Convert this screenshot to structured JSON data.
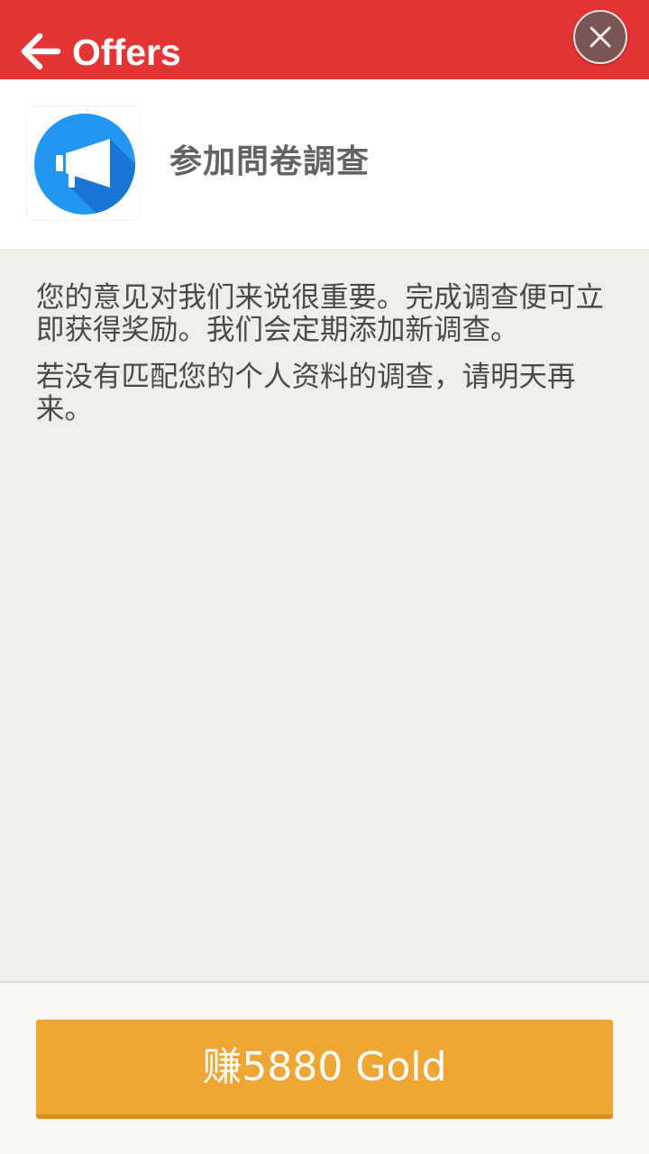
{
  "header": {
    "title": "Offers",
    "back_icon": "arrow-left-icon",
    "close_icon": "close-icon",
    "background_color": "#e53435"
  },
  "offer": {
    "icon": "megaphone-icon",
    "icon_color": "#2196f3",
    "title": "参加問卷調查"
  },
  "description": {
    "paragraph_1": "您的意见对我们来说很重要。完成调查便可立即获得奖励。我们会定期添加新调查。",
    "paragraph_2": "若没有匹配您的个人资料的调查，请明天再来。"
  },
  "action": {
    "earn_label": "赚5880 Gold",
    "button_color": "#efa634"
  }
}
